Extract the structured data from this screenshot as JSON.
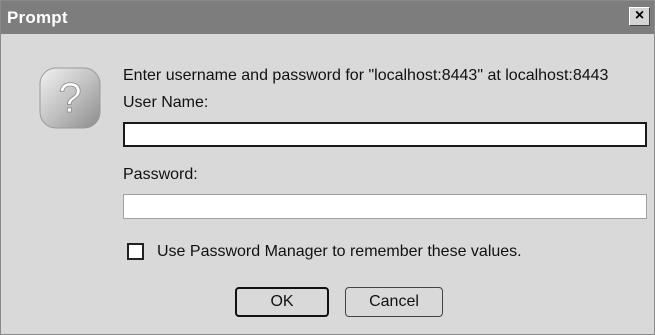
{
  "window": {
    "title": "Prompt",
    "close_glyph": "×"
  },
  "dialog": {
    "icon": "question-icon",
    "message": "Enter username and password for \"localhost:8443\" at localhost:8443",
    "username_label": "User Name:",
    "username_value": "",
    "password_label": "Password:",
    "password_value": "",
    "remember_label": "Use Password Manager to remember these values.",
    "remember_checked": false,
    "ok_label": "OK",
    "cancel_label": "Cancel"
  },
  "colors": {
    "titlebar": "#7d7d7d",
    "dialog_bg": "#d9d9d9"
  }
}
